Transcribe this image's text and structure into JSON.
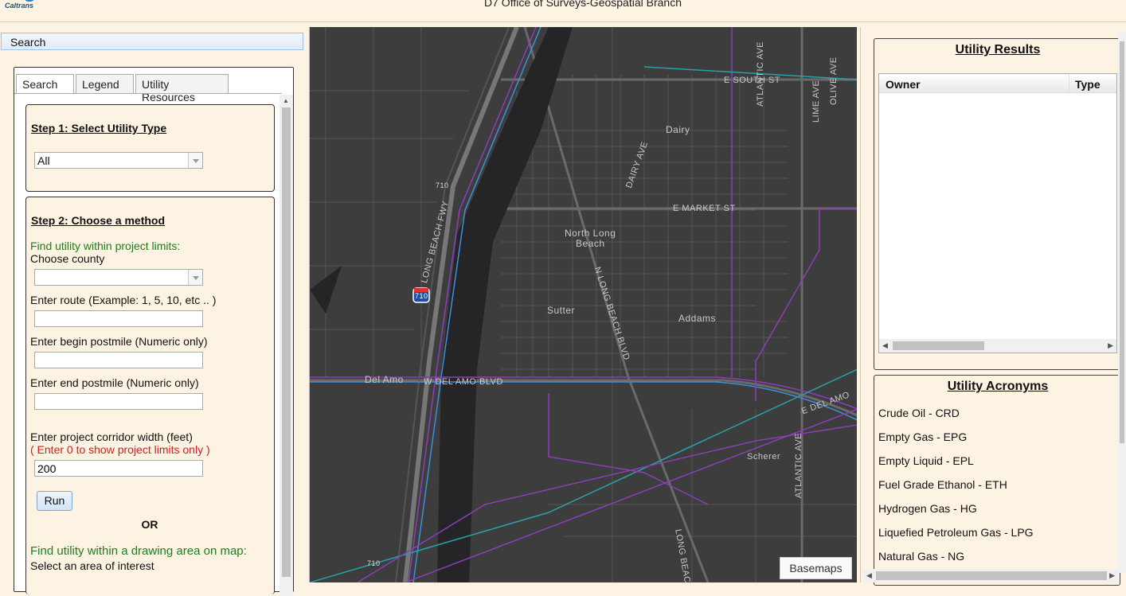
{
  "header": {
    "logo_text": "Caltrans",
    "title": "D7 Office of Surveys-Geospatial Branch"
  },
  "left_panel": {
    "search_bar_label": "Search",
    "tabs": [
      {
        "label": "Search",
        "active": true
      },
      {
        "label": "Legend",
        "active": false
      },
      {
        "label": "Utility Resources",
        "active": false
      }
    ],
    "step1": {
      "title": "Step 1: Select Utility Type",
      "utility_type_selected": "All"
    },
    "step2": {
      "title": "Step 2: Choose a method",
      "find_within_limits": "Find utility within project limits:",
      "choose_county": "Choose county",
      "county_selected": "",
      "route_label": "Enter route (Example: 1, 5, 10, etc .. )",
      "route_value": "",
      "begin_postmile_label": "Enter begin postmile (Numeric only)",
      "begin_postmile_value": "",
      "end_postmile_label": "Enter end postmile (Numeric only)",
      "end_postmile_value": "",
      "corridor_label": "Enter project corridor width (feet)",
      "corridor_hint": "( Enter 0 to show project limits only )",
      "corridor_value": "200",
      "run_label": "Run",
      "or_label": "OR",
      "find_within_drawing": "Find utility within a drawing area on map:",
      "select_area": "Select an area of interest"
    }
  },
  "map": {
    "labels": {
      "e_south_st": "E SOUTH ST",
      "atlantic_ave_top": "ATLANTIC AVE",
      "lime_ave": "LIME AVE",
      "olive_ave": "OLIVE AVE",
      "dairy": "Dairy",
      "dairy_ave": "DAIRY AVE",
      "e_market_st": "E MARKET ST",
      "north_long_beach_1": "North Long",
      "north_long_beach_2": "Beach",
      "long_beach_fwy": "LONG BEACH FWY",
      "n_long_beach_blvd": "N LONG BEACH BLVD",
      "sutter": "Sutter",
      "addams": "Addams",
      "del_amo": "Del Amo",
      "w_del_amo_blvd": "W DEL AMO BLVD",
      "e_del_amo": "E DEL AMO",
      "scherer": "Scherer",
      "atlantic_ave_bottom": "ATLANTIC AVE",
      "long_beach_bottom": "LONG BEACH",
      "shield_710_a": "710",
      "shield_710_b": "710",
      "shield_710_c": "710"
    },
    "basemaps_label": "Basemaps"
  },
  "right_panel": {
    "results_title": "Utility Results",
    "columns": [
      "Owner",
      "Type"
    ],
    "rows": [],
    "acronyms_title": "Utility Acronyms",
    "acronyms": [
      "Crude Oil - CRD",
      "Empty Gas - EPG",
      "Empty Liquid - EPL",
      "Fuel Grade Ethanol - ETH",
      "Hydrogen Gas - HG",
      "Liquefied Petroleum Gas - LPG",
      "Natural Gas - NG"
    ]
  },
  "colors": {
    "panel_bg": "#fdf3e3",
    "map_bg": "#3d3d3e",
    "green_text": "#1e7d1e",
    "red_text": "#e01a1a",
    "utility_purple": "#8a3fb8",
    "utility_blue": "#3f8fd8",
    "utility_teal": "#2aa0a8"
  }
}
